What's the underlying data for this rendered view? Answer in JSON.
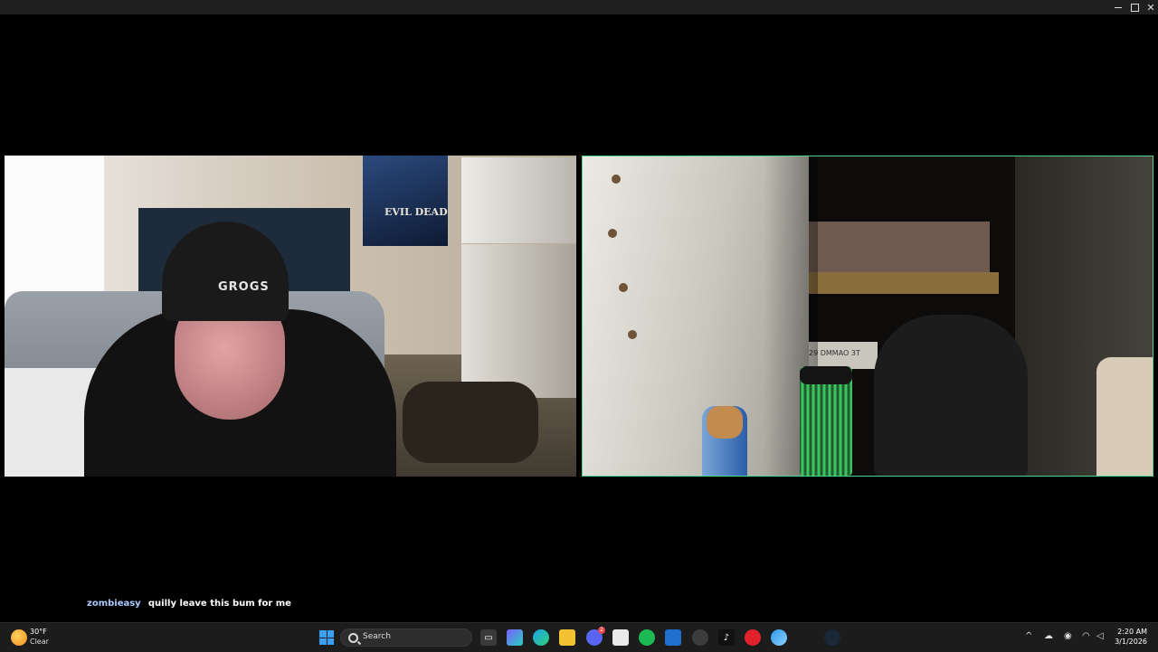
{
  "chat": {
    "username": "zombieasy",
    "message": "quilly leave this bum for me"
  },
  "left_video": {
    "poster_text": "EVIL DEAD",
    "beanie_text": "GROGS"
  },
  "right_video": {
    "box_text": "29 DMMAO 3T"
  },
  "taskbar": {
    "weather_temp": "30°F",
    "weather_condition": "Clear",
    "search_placeholder": "Search",
    "discord_badge": "2",
    "clock_time": "2:20 AM",
    "clock_date": "3/1/2026"
  },
  "colors": {
    "active_speaker_border": "#4fd38a",
    "chat_username": "#a9c9ff",
    "taskbar_bg": "#1c1c1c"
  },
  "icons": [
    "minimize-icon",
    "maximize-icon",
    "close-icon",
    "weather-icon",
    "windows-start-icon",
    "search-icon",
    "task-view-icon",
    "copilot-icon",
    "edge-icon",
    "file-explorer-icon",
    "discord-icon",
    "store-icon",
    "spotify-icon",
    "outlook-icon",
    "chat-app-icon",
    "tiktok-icon",
    "opera-icon",
    "browser-icon",
    "steam-icon",
    "chevron-up-icon",
    "onedrive-icon",
    "microphone-icon",
    "wifi-icon",
    "speaker-icon"
  ]
}
